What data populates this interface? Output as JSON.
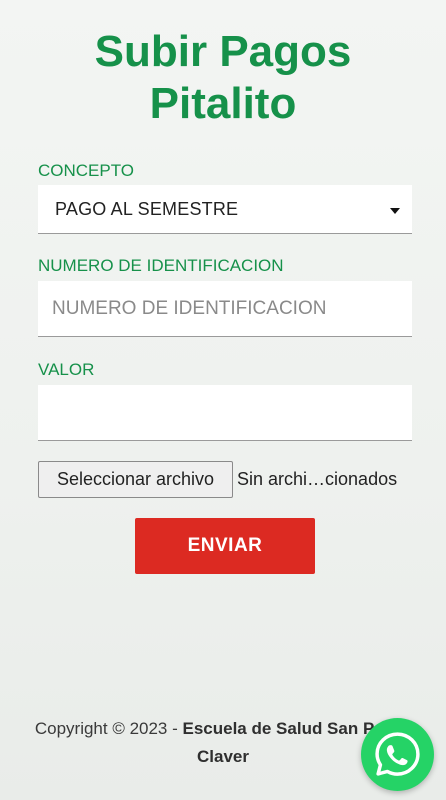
{
  "header": {
    "title_line1": "Subir Pagos",
    "title_line2": "Pitalito"
  },
  "form": {
    "concepto": {
      "label": "CONCEPTO",
      "selected": "PAGO AL SEMESTRE"
    },
    "identificacion": {
      "label": "NUMERO DE IDENTIFICACION",
      "placeholder": "NUMERO DE IDENTIFICACION",
      "value": ""
    },
    "valor": {
      "label": "VALOR",
      "placeholder": "",
      "value": ""
    },
    "archivo": {
      "button_label": "Seleccionar archivo",
      "status": "Sin archi…cionados"
    },
    "submit_label": "ENVIAR"
  },
  "footer": {
    "copyright_prefix": "Copyright © 2023 - ",
    "org_name_line1": "Escuela de Salud San Pedro",
    "org_name_line2": "Claver"
  },
  "colors": {
    "accent_green": "#16914a",
    "submit_red": "#dc2a22",
    "whatsapp_green": "#25d366"
  },
  "icons": {
    "select_caret": "caret-down-icon",
    "whatsapp": "whatsapp-icon"
  }
}
